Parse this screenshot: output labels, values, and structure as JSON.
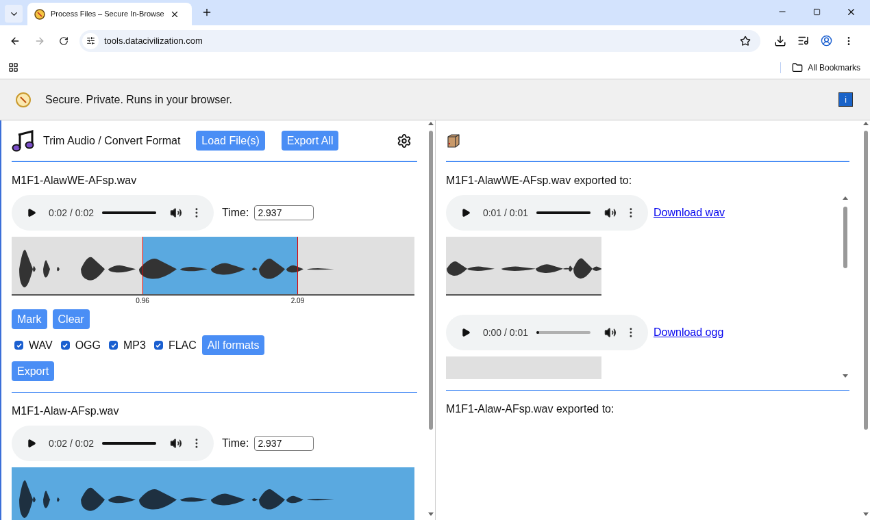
{
  "browser": {
    "tab_title": "Process Files – Secure In-Browse",
    "url": "tools.datacivilization.com",
    "bookmarks": "All Bookmarks"
  },
  "banner": {
    "text": "Secure. Private. Runs in your browser.",
    "info_button": "i"
  },
  "left_panel": {
    "title": "Trim Audio / Convert Format",
    "buttons": [
      "Load File(s)",
      "Export All"
    ],
    "files": [
      {
        "name": "M1F1-AlawWE-AFsp.wav",
        "player": {
          "time": "0:02 / 0:02",
          "level": 1
        },
        "time_label": "Time:",
        "time_value": "2.937",
        "waveform": {
          "kind": "range",
          "markers": [
            {
              "label": "0.96",
              "level": 0.325
            },
            {
              "label": "2.09",
              "level": 0.71
            }
          ]
        },
        "actions": [
          "Mark",
          "Clear"
        ],
        "formats": [
          {
            "label": "WAV",
            "checked": true
          },
          {
            "label": "OGG",
            "checked": true
          },
          {
            "label": "MP3",
            "checked": true
          },
          {
            "label": "FLAC",
            "checked": true
          }
        ],
        "all_formats": "All formats",
        "export": "Export"
      },
      {
        "name": "M1F1-Alaw-AFsp.wav",
        "player": {
          "time": "0:02 / 0:02",
          "level": 1
        },
        "time_label": "Time:",
        "time_value": "2.937",
        "waveform": {
          "kind": "all"
        }
      }
    ]
  },
  "right_panel": {
    "exports": [
      {
        "source": "M1F1-AlawWE-AFsp.wav exported to:",
        "outputs": [
          {
            "player": {
              "time": "0:01 / 0:01",
              "level": 1
            },
            "link": "Download wav",
            "waveform": {
              "kind": "full"
            }
          },
          {
            "player": {
              "time": "0:00 / 0:01",
              "level": 0
            },
            "link": "Download ogg",
            "waveform": {
              "kind": "clipped"
            }
          }
        ]
      },
      {
        "source": "M1F1-Alaw-AFsp.wav exported to:"
      }
    ]
  }
}
